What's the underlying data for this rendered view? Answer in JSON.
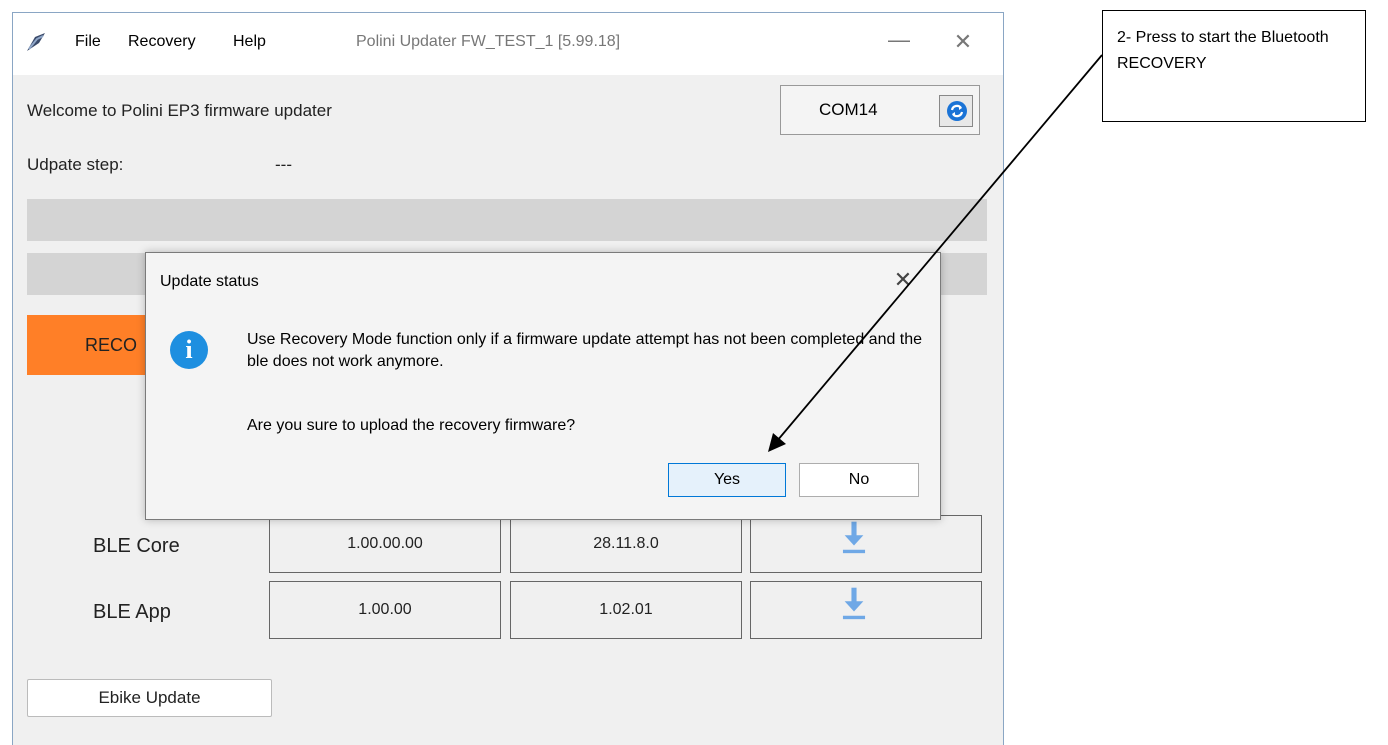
{
  "window": {
    "menu": [
      "File",
      "Recovery",
      "Help"
    ],
    "title": "Polini Updater FW_TEST_1 [5.99.18]",
    "minimize": "—",
    "close": "✕"
  },
  "header": {
    "welcome": "Welcome to Polini EP3 firmware updater",
    "com_port": "COM14",
    "step_label": "Udpate step:",
    "step_value": "---"
  },
  "recovery_button": {
    "label": "RECO"
  },
  "firmware_table": {
    "rows": [
      {
        "label": "BLE Core",
        "current": "1.00.00.00",
        "latest": "28.11.8.0"
      },
      {
        "label": "BLE App",
        "current": "1.00.00",
        "latest": "1.02.01"
      }
    ]
  },
  "ebike_update": {
    "label": "Ebike Update"
  },
  "dialog": {
    "title": "Update status",
    "close": "✕",
    "message": "Use Recovery Mode function only if a firmware update attempt has not been completed and the ble does not work anymore.",
    "question": "Are you sure to upload the recovery firmware?",
    "yes": "Yes",
    "no": "No"
  },
  "annotation": {
    "text": "2- Press to start the Bluetooth RECOVERY"
  },
  "colors": {
    "recovery_orange": "#ff7f27",
    "info_blue": "#1e8fe0",
    "download_blue": "#6fa8e6"
  },
  "icons": [
    "app-logo-icon",
    "refresh-icon",
    "info-icon",
    "download-icon"
  ]
}
